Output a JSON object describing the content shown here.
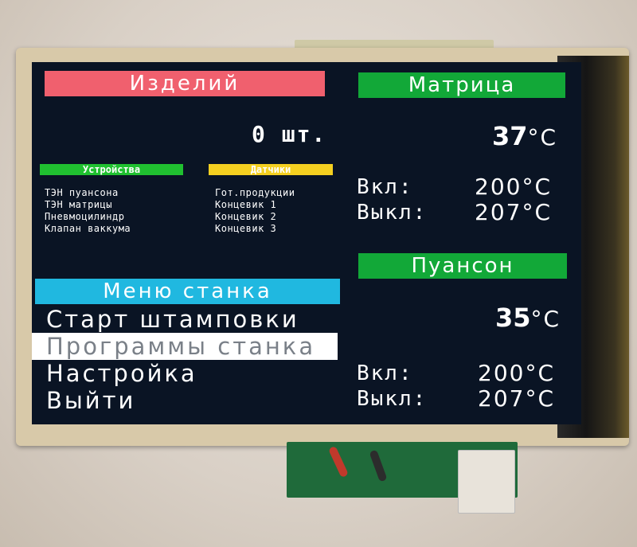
{
  "left": {
    "products_header": "Изделий",
    "count_value": "0 шт.",
    "devices": {
      "title": "Устройства",
      "items": [
        "ТЭН пуансона",
        "ТЭН матрицы",
        "Пневмоцилиндр",
        "Клапан ваккума"
      ]
    },
    "sensors": {
      "title": "Датчики",
      "items": [
        "Гот.продукции",
        "Концевик 1",
        "Концевик 2",
        "Концевик 3"
      ]
    }
  },
  "menu": {
    "title": "Меню станка",
    "items": [
      {
        "label": "Старт штамповки",
        "selected": false
      },
      {
        "label": "Программы станка",
        "selected": true
      },
      {
        "label": "Настройка",
        "selected": false
      },
      {
        "label": "Выйти",
        "selected": false
      }
    ]
  },
  "matrix": {
    "title": "Матрица",
    "temp": "37",
    "unit": "°С",
    "on_label": "Вкл:",
    "on_value": "200°С",
    "off_label": "Выкл:",
    "off_value": "207°С"
  },
  "punch": {
    "title": "Пуансон",
    "temp": "35",
    "unit": "°С",
    "on_label": "Вкл:",
    "on_value": "200°С",
    "off_label": "Выкл:",
    "off_value": "207°С"
  },
  "colors": {
    "screen_bg": "#0a1424",
    "products_header_bg": "#f0606e",
    "menu_header_bg": "#20b8e0",
    "section_header_bg": "#12a838",
    "devices_tag_bg": "#20c030",
    "sensors_tag_bg": "#f5d020",
    "selected_item_bg": "#ffffff"
  }
}
